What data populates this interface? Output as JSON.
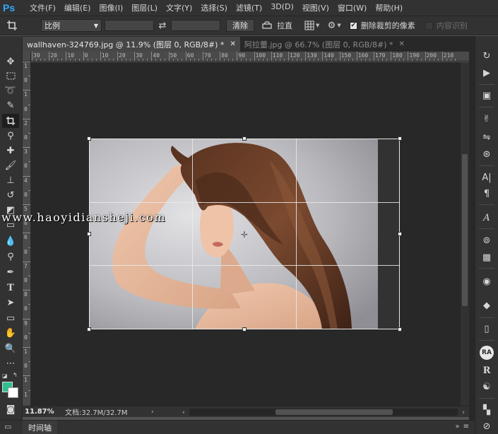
{
  "app": {
    "logo": "Ps"
  },
  "menu": [
    "文件(F)",
    "编辑(E)",
    "图像(I)",
    "图层(L)",
    "文字(Y)",
    "选择(S)",
    "滤镜(T)",
    "3D(D)",
    "视图(V)",
    "窗口(W)",
    "帮助(H)"
  ],
  "options": {
    "ratio_label": "比例",
    "clear_label": "清除",
    "straighten_label": "拉直",
    "delete_cropped_label": "删除裁剪的像素",
    "content_aware_label": "内容识别"
  },
  "tabs": [
    {
      "label": "wallhaven-324769.jpg @ 11.9% (图层 0, RGB/8#) *",
      "active": true
    },
    {
      "label": "阿拉蕾.jpg @ 66.7% (图层 0, RGB/8#) *",
      "active": false
    }
  ],
  "ruler": {
    "h_labels": [
      "30",
      "20",
      "10",
      "0",
      "10",
      "20",
      "30",
      "40",
      "50",
      "60",
      "70",
      "80",
      "90",
      "100",
      "110",
      "120",
      "130",
      "140",
      "150",
      "160",
      "170",
      "180",
      "190",
      "200",
      "210"
    ],
    "v_labels": [
      "1",
      "0",
      "1",
      "0",
      "2",
      "0",
      "3",
      "0",
      "4",
      "0",
      "5",
      "0",
      "6",
      "0",
      "7",
      "0",
      "8",
      "0",
      "9",
      "0",
      "1",
      "0",
      "1",
      "1"
    ]
  },
  "watermark": "www.haoyidiansheji.com",
  "status": {
    "zoom": "11.87%",
    "doc_info": "文档:32.7M/32.7M"
  },
  "timeline": {
    "label": "时间轴"
  },
  "colors": {
    "foreground": "#2fbf8f",
    "background": "#ffffff",
    "ps_blue": "#31a8ff"
  }
}
